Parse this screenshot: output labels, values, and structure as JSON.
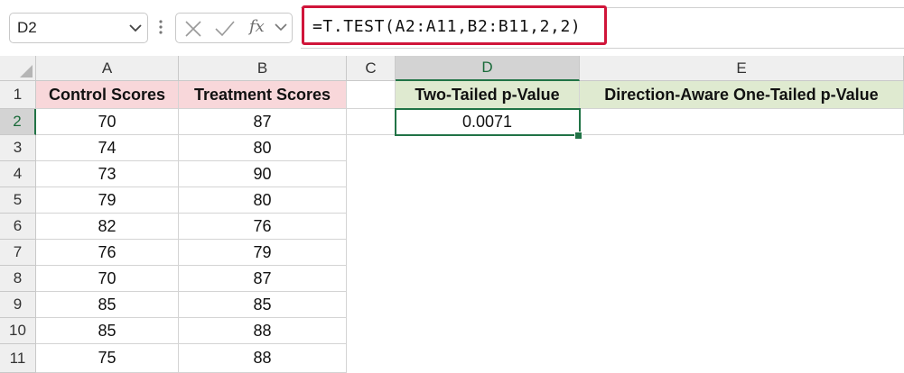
{
  "name_box": {
    "value": "D2"
  },
  "formula_bar": {
    "fx_label": "fx",
    "formula": "=T.TEST(A2:A11,B2:B11,2,2)"
  },
  "colors": {
    "highlight_border": "#d0153a",
    "header_pink": "#f8d7da",
    "header_green": "#dfead0",
    "selection_green": "#217346"
  },
  "columns": [
    "A",
    "B",
    "C",
    "D",
    "E"
  ],
  "rows": [
    "1",
    "2",
    "3",
    "4",
    "5",
    "6",
    "7",
    "8",
    "9",
    "10",
    "11"
  ],
  "headers": {
    "A": "Control Scores",
    "B": "Treatment Scores",
    "D": "Two-Tailed p-Value",
    "E": "Direction-Aware One-Tailed p-Value"
  },
  "data": {
    "control": [
      "70",
      "74",
      "73",
      "79",
      "82",
      "76",
      "70",
      "85",
      "85",
      "75"
    ],
    "treatment": [
      "87",
      "80",
      "90",
      "80",
      "76",
      "79",
      "87",
      "85",
      "88",
      "88"
    ],
    "d2": "0.0071",
    "e2": ""
  },
  "active_cell": {
    "column": "D",
    "row": "2"
  }
}
